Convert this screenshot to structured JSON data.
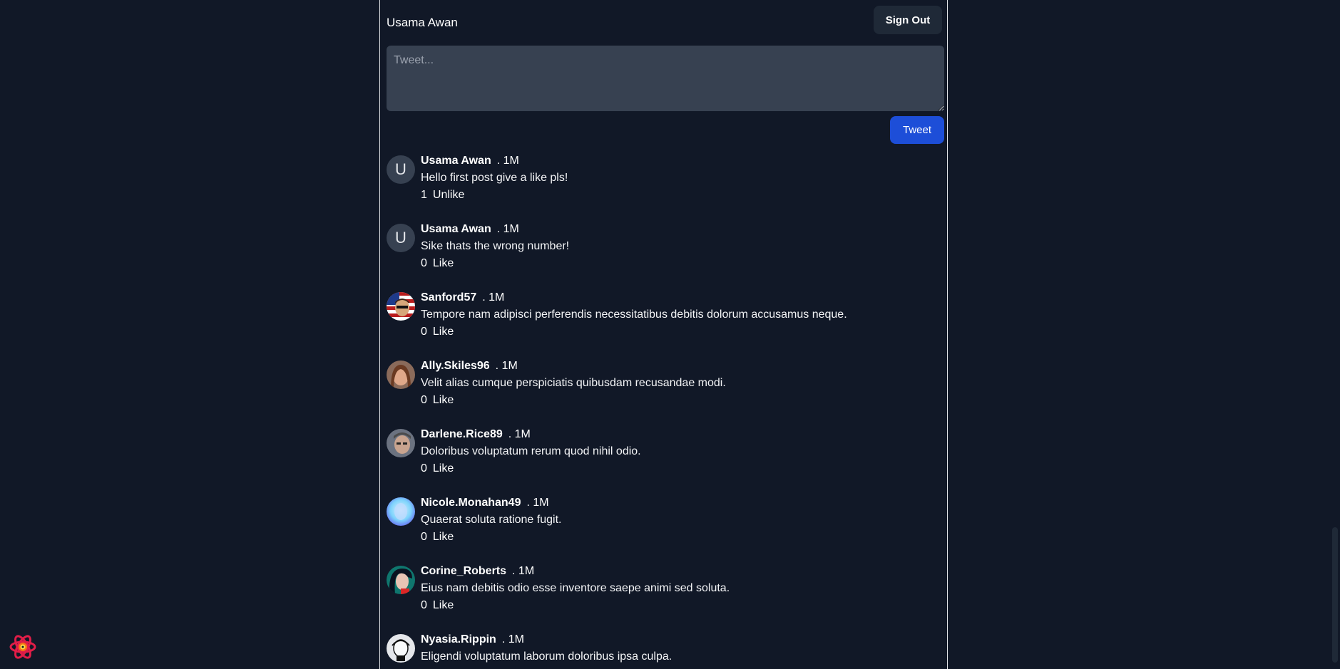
{
  "header": {
    "user_name": "Usama Awan",
    "sign_out_label": "Sign Out"
  },
  "composer": {
    "placeholder": "Tweet...",
    "tweet_button_label": "Tweet"
  },
  "posts": [
    {
      "author": "Usama Awan",
      "time": ". 1M",
      "text": "Hello first post give a like pls!",
      "likes": "1",
      "action": "Unlike",
      "avatar": "letter-u",
      "avatar_letter": "U"
    },
    {
      "author": "Usama Awan",
      "time": ". 1M",
      "text": "Sike thats the wrong number!",
      "likes": "0",
      "action": "Like",
      "avatar": "letter-u",
      "avatar_letter": "U"
    },
    {
      "author": "Sanford57",
      "time": ". 1M",
      "text": "Tempore nam adipisci perferendis necessitatibus debitis dolorum accusamus neque.",
      "likes": "0",
      "action": "Like",
      "avatar": "flag-photo"
    },
    {
      "author": "Ally.Skiles96",
      "time": ". 1M",
      "text": "Velit alias cumque perspiciatis quibusdam recusandae modi.",
      "likes": "0",
      "action": "Like",
      "avatar": "woman-photo"
    },
    {
      "author": "Darlene.Rice89",
      "time": ". 1M",
      "text": "Doloribus voluptatum rerum quod nihil odio.",
      "likes": "0",
      "action": "Like",
      "avatar": "man-photo"
    },
    {
      "author": "Nicole.Monahan49",
      "time": ". 1M",
      "text": "Quaerat soluta ratione fugit.",
      "likes": "0",
      "action": "Like",
      "avatar": "blue-face-photo"
    },
    {
      "author": "Corine_Roberts",
      "time": ". 1M",
      "text": "Eius nam debitis odio esse inventore saepe animi sed soluta.",
      "likes": "0",
      "action": "Like",
      "avatar": "dark-hair-photo"
    },
    {
      "author": "Nyasia.Rippin",
      "time": ". 1M",
      "text": "Eligendi voluptatum laborum doloribus ipsa culpa.",
      "likes": "",
      "action": "",
      "avatar": "sketch-photo"
    }
  ],
  "colors": {
    "background": "#111827",
    "accent": "#1d4ed8",
    "input": "#374151"
  },
  "icons": {
    "devtools": "react-logo-icon"
  }
}
